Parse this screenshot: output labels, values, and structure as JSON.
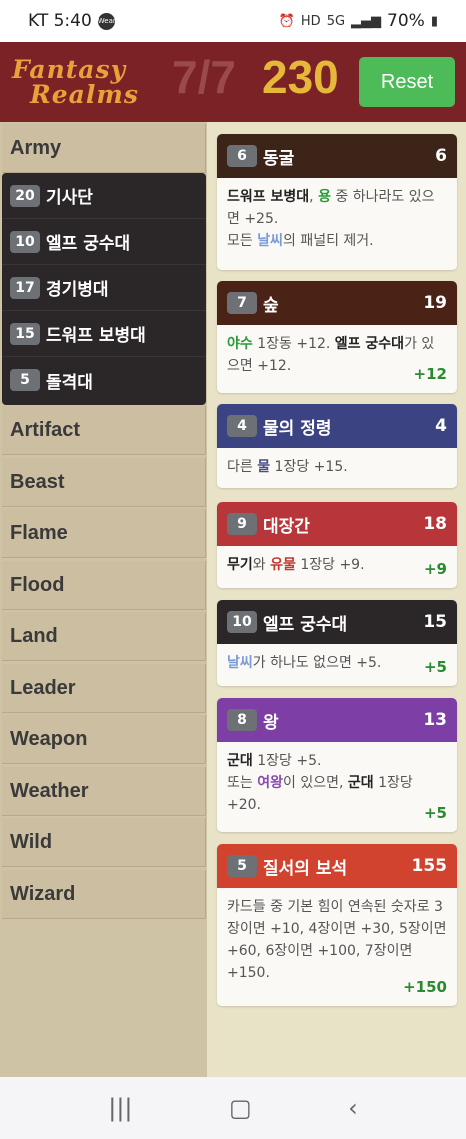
{
  "status": {
    "carrier": "KT 5:40",
    "wear": "Wear",
    "network": "5G",
    "battery": "70%"
  },
  "header": {
    "logo_line1": "Fantasy",
    "logo_line2": "Realms",
    "hand_count": "7/7",
    "score": "230",
    "reset_label": "Reset"
  },
  "categories": [
    "Army",
    "Artifact",
    "Beast",
    "Flame",
    "Flood",
    "Land",
    "Leader",
    "Weapon",
    "Weather",
    "Wild",
    "Wizard"
  ],
  "army_cards": [
    {
      "num": "20",
      "name": "기사단"
    },
    {
      "num": "10",
      "name": "엘프 궁수대"
    },
    {
      "num": "17",
      "name": "경기병대"
    },
    {
      "num": "15",
      "name": "드워프 보병대"
    },
    {
      "num": "5",
      "name": "돌격대"
    }
  ],
  "hand": [
    {
      "num": "6",
      "name": "동굴",
      "pts": "6",
      "color": "#3d2418",
      "text": [
        "드워프 보병대",
        ", ",
        "용",
        " 중 하나라도 있으면 +25.",
        "모든 ",
        "날씨",
        "의 패널티 제거."
      ],
      "bonus": ""
    },
    {
      "num": "7",
      "name": "숲",
      "pts": "19",
      "color": "#4b2216",
      "text": [
        "야수",
        " 1장동 +12. ",
        "엘프 궁수대",
        "가 있으면 +12."
      ],
      "bonus": "+12"
    },
    {
      "num": "4",
      "name": "물의 정령",
      "pts": "4",
      "color": "#3c4383",
      "text": [
        "다른 ",
        "물",
        " 1장당 +15."
      ],
      "bonus": ""
    },
    {
      "num": "9",
      "name": "대장간",
      "pts": "18",
      "color": "#b8363a",
      "text": [
        "무기",
        "와 ",
        "유물",
        " 1장당 +9."
      ],
      "bonus": "+9"
    },
    {
      "num": "10",
      "name": "엘프 궁수대",
      "pts": "15",
      "color": "#2b2628",
      "text": [
        "날씨",
        "가 하나도 없으면 +5."
      ],
      "bonus": "+5"
    },
    {
      "num": "8",
      "name": "왕",
      "pts": "13",
      "color": "#7d3fa5",
      "text": [
        "군대",
        " 1장당 +5.",
        "또는 ",
        "여왕",
        "이 있으면, ",
        "군대",
        " 1장당 +20."
      ],
      "bonus": "+5"
    },
    {
      "num": "5",
      "name": "질서의 보석",
      "pts": "155",
      "color": "#d2432f",
      "text": [
        "카드들 중 기본 힘이 연속된 숫자로 3장이면 +10, 4장이면 +30, 5장이면 +60, 6장이면 +100, 7장이면 +150."
      ],
      "bonus": "+150"
    }
  ]
}
